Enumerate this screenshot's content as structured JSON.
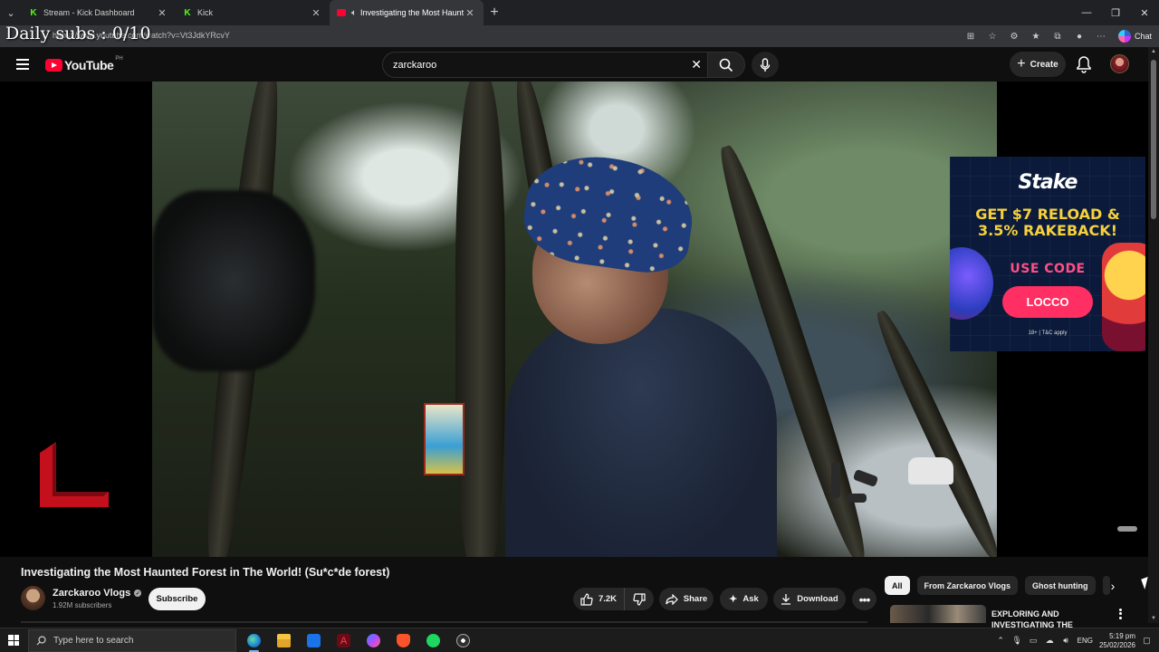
{
  "browser": {
    "tabs": [
      {
        "title": "Stream - Kick Dashboard",
        "favicon": "kick-icon",
        "active": false
      },
      {
        "title": "Kick",
        "favicon": "kick-icon",
        "active": false
      },
      {
        "title": "Investigating the Most Haunte",
        "favicon": "youtube-icon",
        "active": true,
        "audio": "speaker-icon"
      }
    ],
    "url": "https://www.youtube.com/watch?v=Vt3JdkYRcvY",
    "copilot_label": "Chat"
  },
  "overlay": {
    "daily_subs": "Daily subs : 0/10"
  },
  "youtube": {
    "logo_text": "YouTube",
    "country_code": "PH",
    "search_value": "zarckaroo",
    "create_label": "Create",
    "accent": "#ff0033"
  },
  "ad": {
    "brand": "Stake",
    "promo_line1": "GET $7 RELOAD &",
    "promo_line2": "3.5% RAKEBACK!",
    "use_code": "USE CODE",
    "code": "LOCCO",
    "terms": "18+ | T&C apply"
  },
  "video": {
    "title": "Investigating the Most Haunted Forest in The World! (Su*c*de forest)",
    "channel": "Zarckaroo Vlogs",
    "subscribers": "1.92M subscribers",
    "subscribe_label": "Subscribe",
    "likes": "7.2K",
    "share_label": "Share",
    "ask_label": "Ask",
    "download_label": "Download"
  },
  "chips": [
    "All",
    "From Zarckaroo Vlogs",
    "Ghost hunting"
  ],
  "recommendation": {
    "title_line1": "EXPLORING AND",
    "title_line2": "INVESTIGATING THE"
  },
  "taskbar": {
    "search_placeholder": "Type here to search",
    "language": "ENG",
    "time": "5:19 pm",
    "date": "25/02/2026",
    "apps": [
      "edge-icon",
      "file-explorer-icon",
      "outlook-icon",
      "adobe-icon",
      "messenger-icon",
      "brave-icon",
      "spotify-icon",
      "obs-icon"
    ]
  }
}
